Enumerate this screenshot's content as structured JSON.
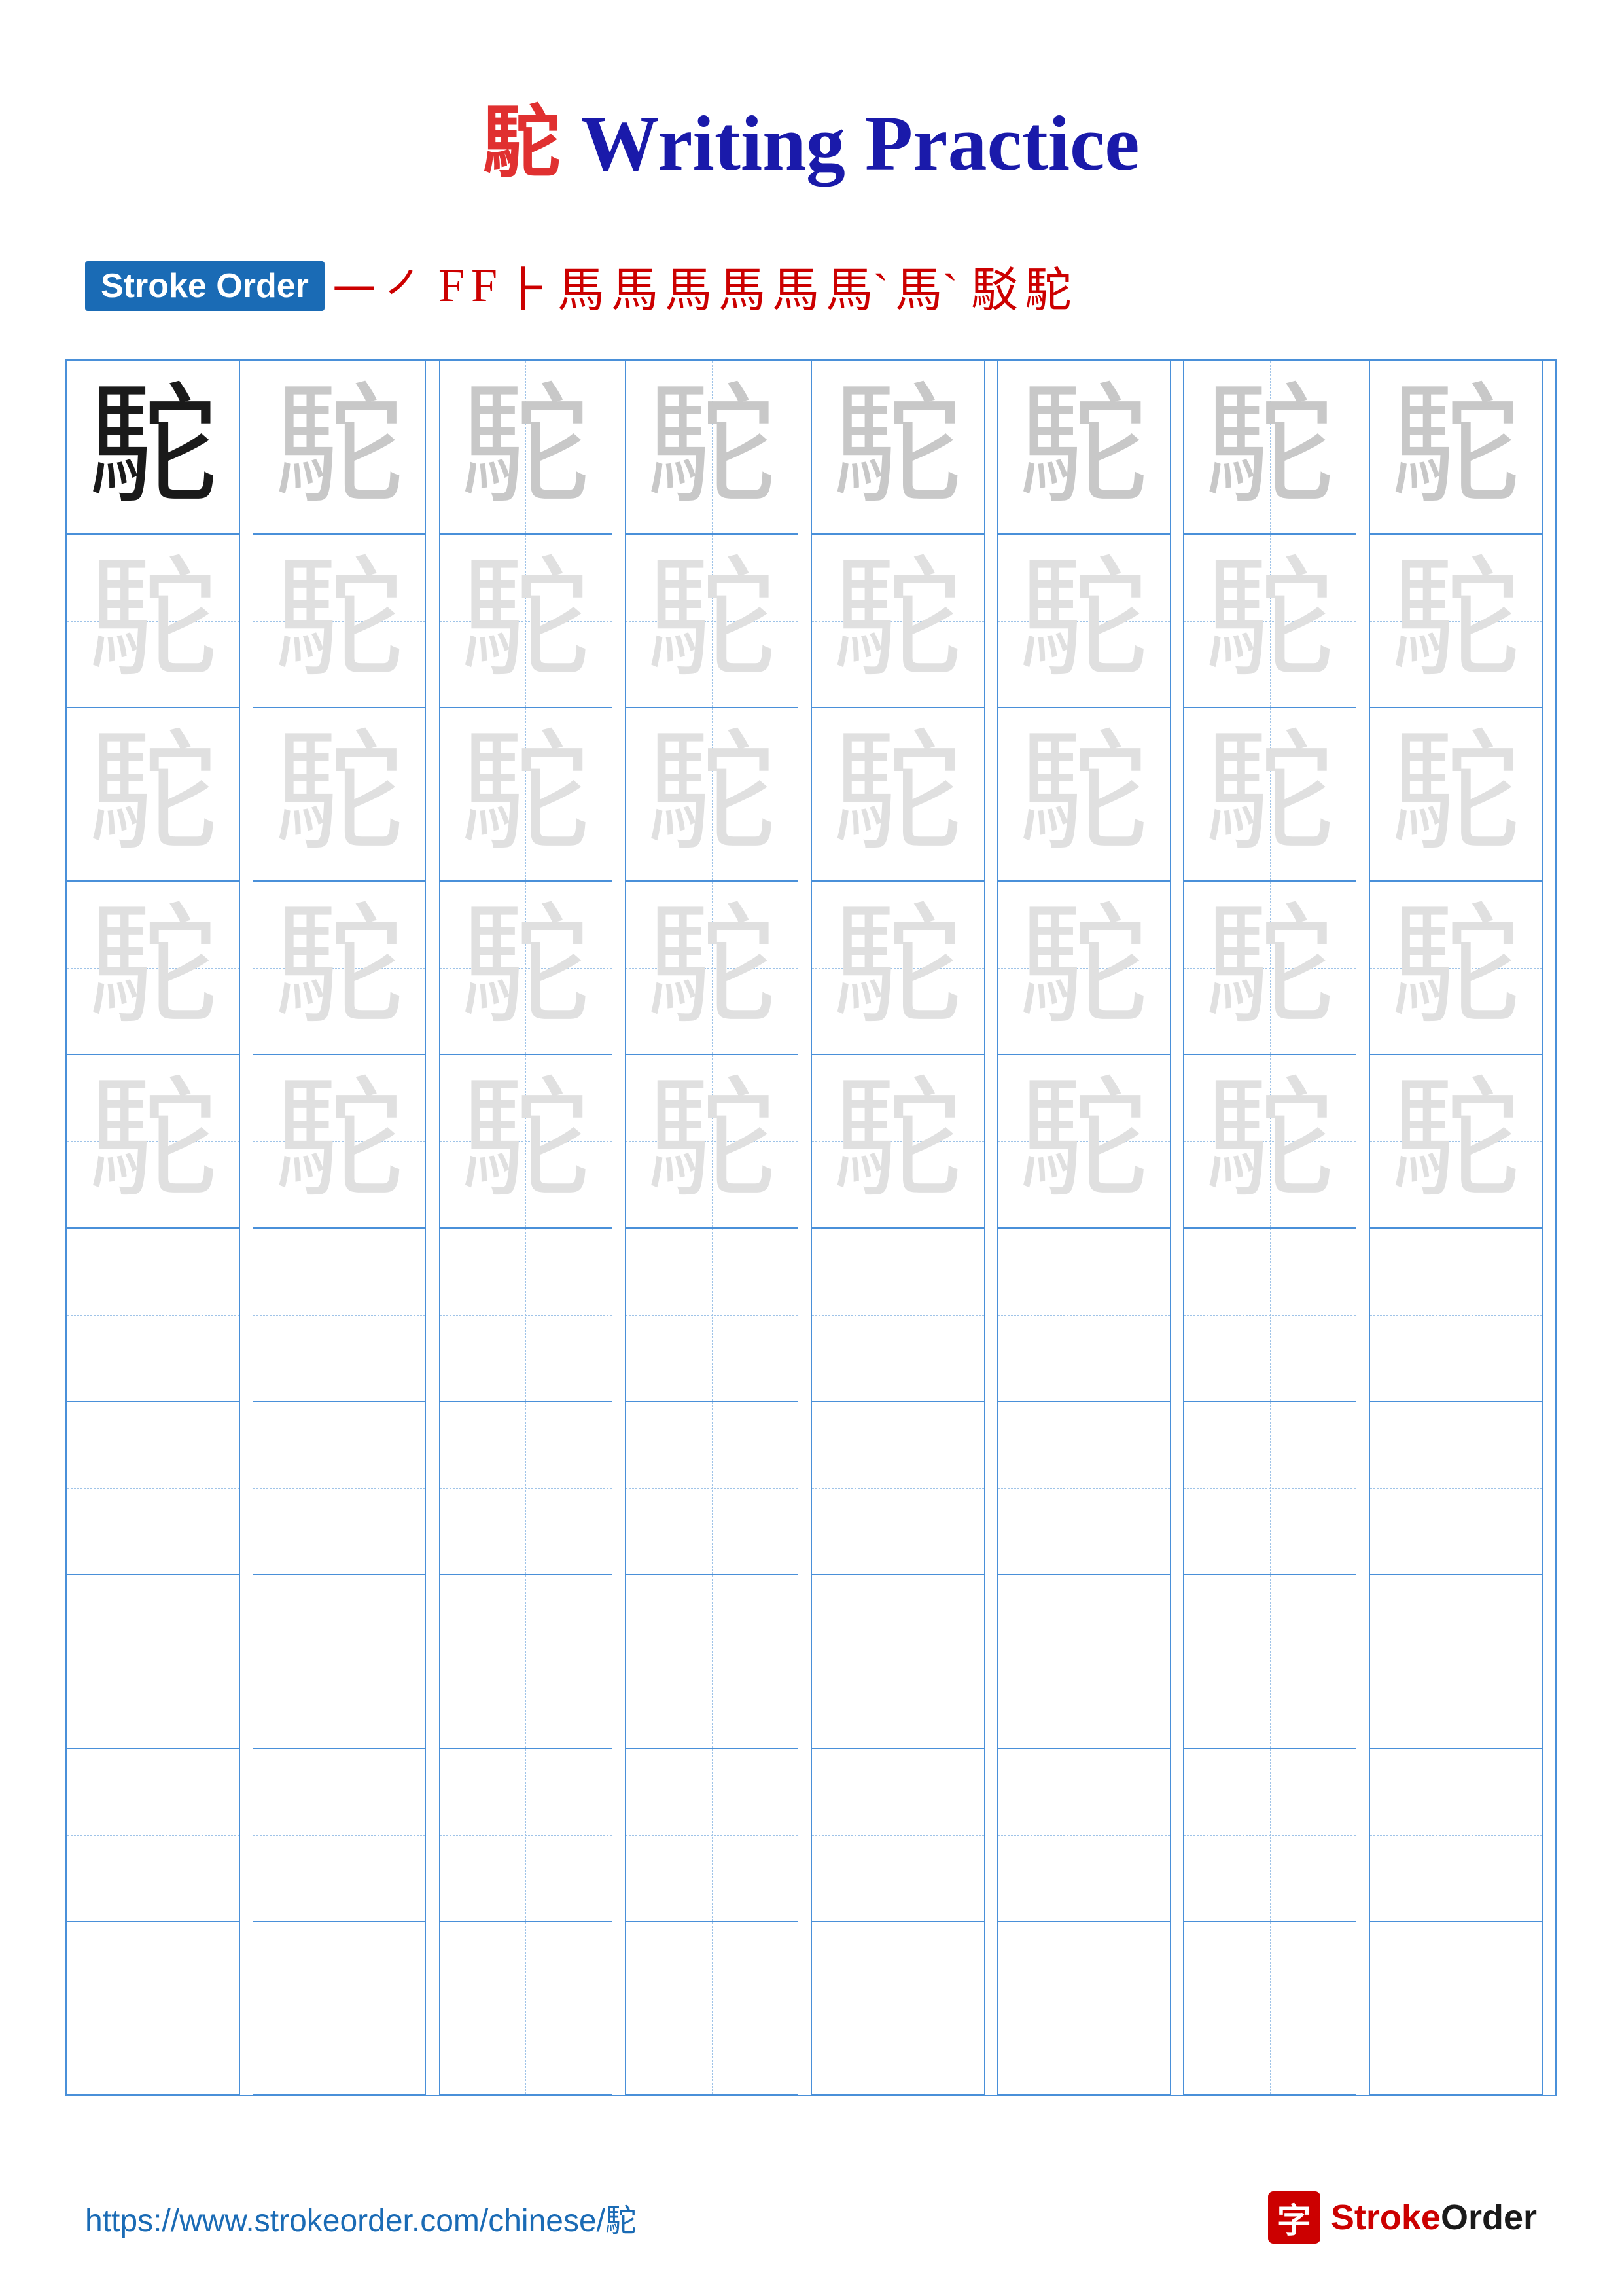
{
  "page": {
    "title_char": "駝",
    "title_text": "Writing Practice"
  },
  "stroke_order": {
    "label": "Stroke Order",
    "steps": [
      "㇐",
      "㇒",
      "F",
      "F",
      "⺊",
      "馬⁻",
      "馬",
      "馬",
      "馬",
      "馬",
      "馬`",
      "馬`",
      "駁",
      "駝"
    ]
  },
  "grid": {
    "char": "駝",
    "rows": 10,
    "cols": 8
  },
  "footer": {
    "url": "https://www.strokeorder.com/chinese/駝",
    "brand_icon": "字",
    "brand_text": "StrokeOrder"
  }
}
